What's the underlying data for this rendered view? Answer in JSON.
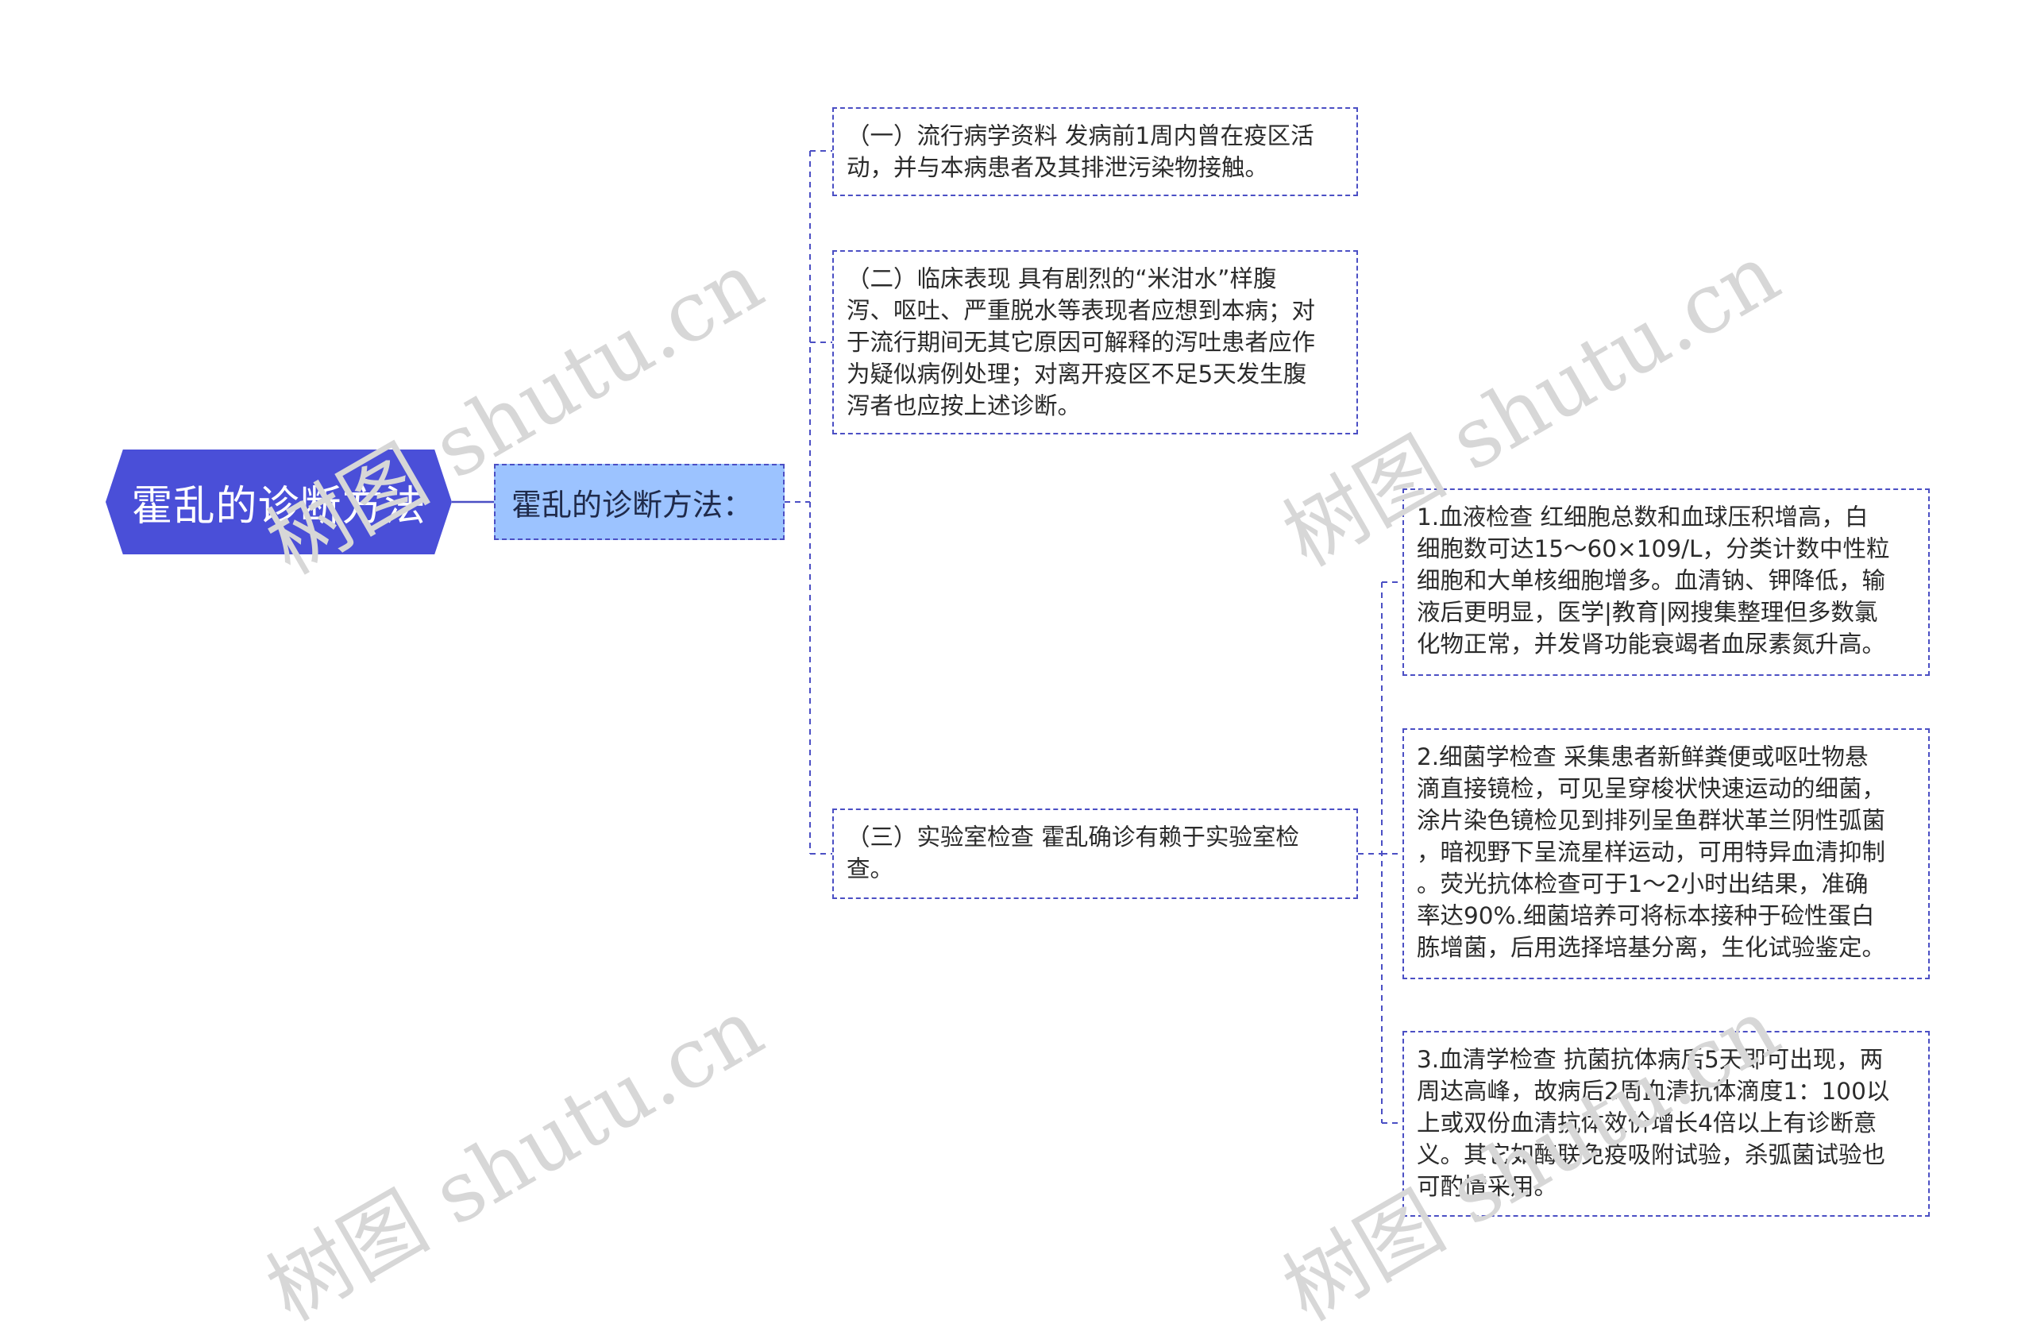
{
  "root": {
    "label": "霍乱的诊断方法"
  },
  "sub": {
    "label": "霍乱的诊断方法："
  },
  "leaves": {
    "epidemiology": {
      "lines": [
        "（一）流行病学资料 发病前1周内曾在疫区活",
        "动，并与本病患者及其排泄污染物接触。"
      ]
    },
    "clinical": {
      "lines": [
        "（二）临床表现 具有剧烈的“米泔水”样腹",
        "泻、呕吐、严重脱水等表现者应想到本病；对",
        "于流行期间无其它原因可解释的泻吐患者应作",
        "为疑似病例处理；对离开疫区不足5天发生腹",
        "泻者也应按上述诊断。"
      ]
    },
    "lab": {
      "lines": [
        "（三）实验室检查 霍乱确诊有赖于实验室检",
        "查。"
      ]
    },
    "blood": {
      "lines": [
        "1.血液检查 红细胞总数和血球压积增高，白",
        "细胞数可达15～60×109/L，分类计数中性粒",
        "细胞和大单核细胞增多。血清钠、钾降低，输",
        "液后更明显，医学|教育|网搜集整理但多数氯",
        "化物正常，并发肾功能衰竭者血尿素氮升高。"
      ]
    },
    "bacteria": {
      "lines": [
        "2.细菌学检查 采集患者新鲜粪便或呕吐物悬",
        "滴直接镜检，可见呈穿梭状快速运动的细菌，",
        "涂片染色镜检见到排列呈鱼群状革兰阴性弧菌",
        "，暗视野下呈流星样运动，可用特异血清抑制",
        "。荧光抗体检查可于1～2小时出结果，准确",
        "率达90%.细菌培养可将标本接种于硷性蛋白",
        "胨增菌，后用选择培基分离，生化试验鉴定。"
      ]
    },
    "serology": {
      "lines": [
        "3.血清学检查 抗菌抗体病后5天即可出现，两",
        "周达高峰，故病后2周血清抗体滴度1：100以",
        "上或双份血清抗体效价增长4倍以上有诊断意",
        "义。其它如酶联免疫吸附试验，杀弧菌试验也",
        "可酌情采用。"
      ]
    }
  },
  "watermark": {
    "text": "树图 shutu.cn"
  },
  "colors": {
    "root": "#4a4fd8",
    "sub": "#9cc3ff",
    "line": "#4b4fc4"
  }
}
